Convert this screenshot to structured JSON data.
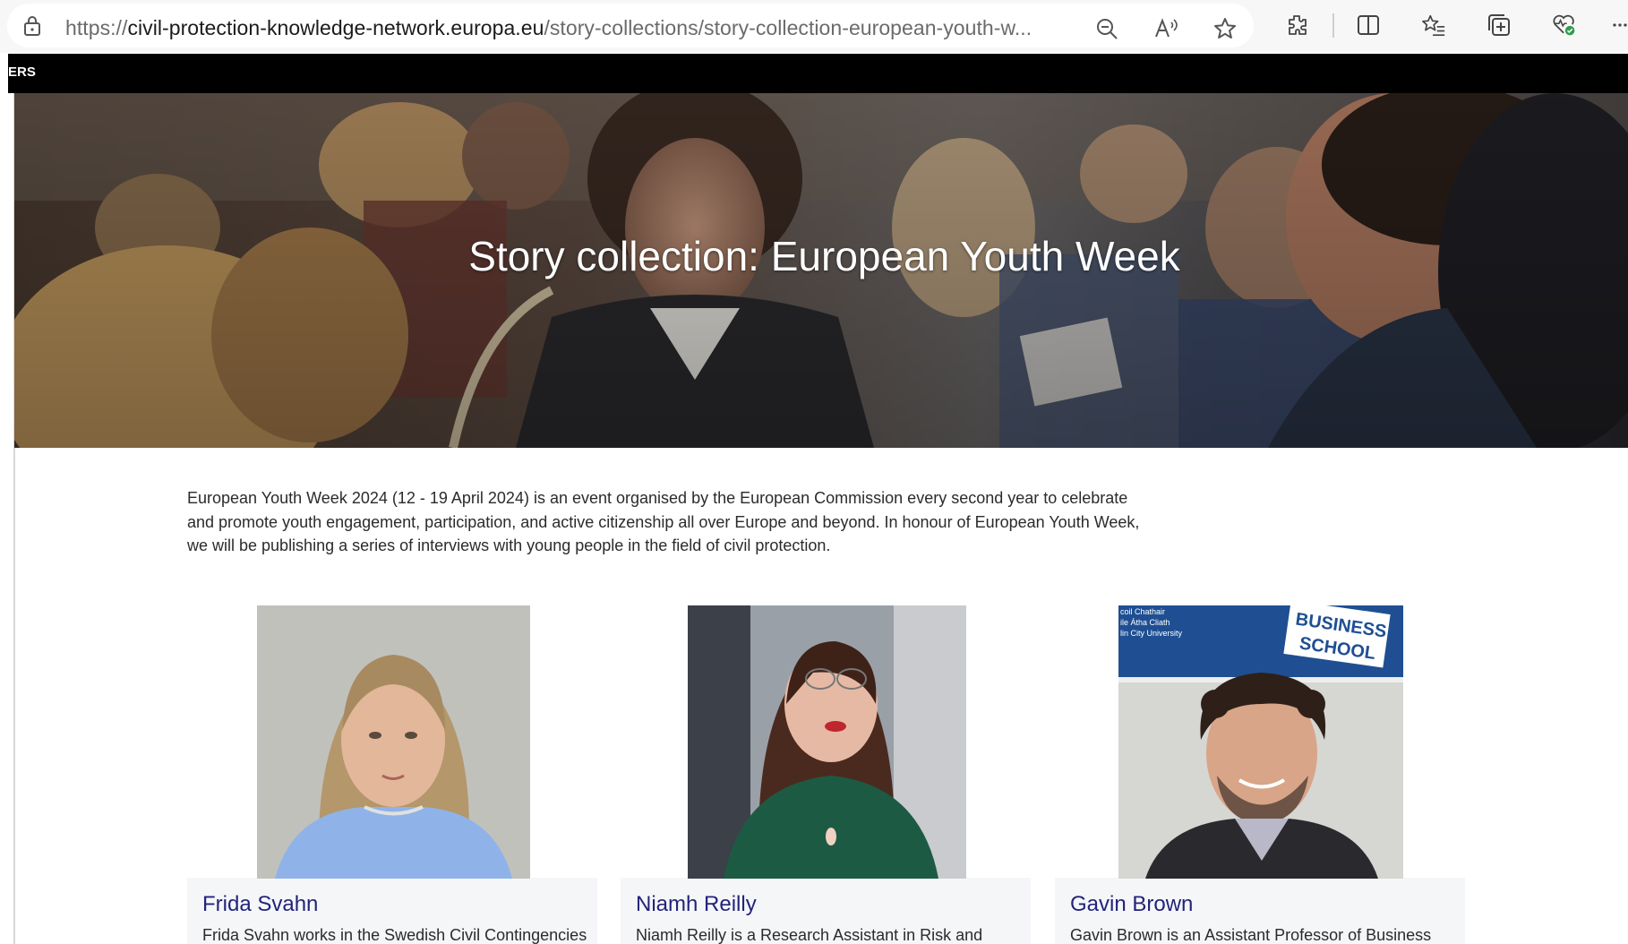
{
  "browser": {
    "url_scheme": "https://",
    "url_host": "civil-protection-knowledge-network.europa.eu",
    "url_path": "/story-collections/story-collection-european-youth-w..."
  },
  "site_nav": {
    "label": "ERS"
  },
  "hero": {
    "title": "Story collection: European Youth Week"
  },
  "intro": {
    "text": "European Youth Week 2024 (12 - 19 April 2024) is an event organised by the European Commission every second year to celebrate and promote youth engagement, participation, and active citizenship all over Europe and beyond. In honour of European Youth Week, we will be publishing a series of interviews with young people in the field of civil protection."
  },
  "cards": [
    {
      "name": "Frida Svahn",
      "desc": "Frida Svahn works in the Swedish Civil Contingencies"
    },
    {
      "name": "Niamh Reilly",
      "desc": "Niamh Reilly is a Research Assistant in Risk and"
    },
    {
      "name": "Gavin Brown",
      "desc": "Gavin Brown is an Assistant Professor of Business"
    }
  ],
  "photo_signage": {
    "sign_left": [
      "coil Chathair",
      "ile Átha Cliath",
      "lin City University"
    ],
    "sign_right": [
      "BUSINESS",
      "SCHOOL"
    ]
  },
  "colors": {
    "card_name": "#23237a",
    "site_bar": "#000000",
    "card_panel": "#f5f6f8"
  }
}
